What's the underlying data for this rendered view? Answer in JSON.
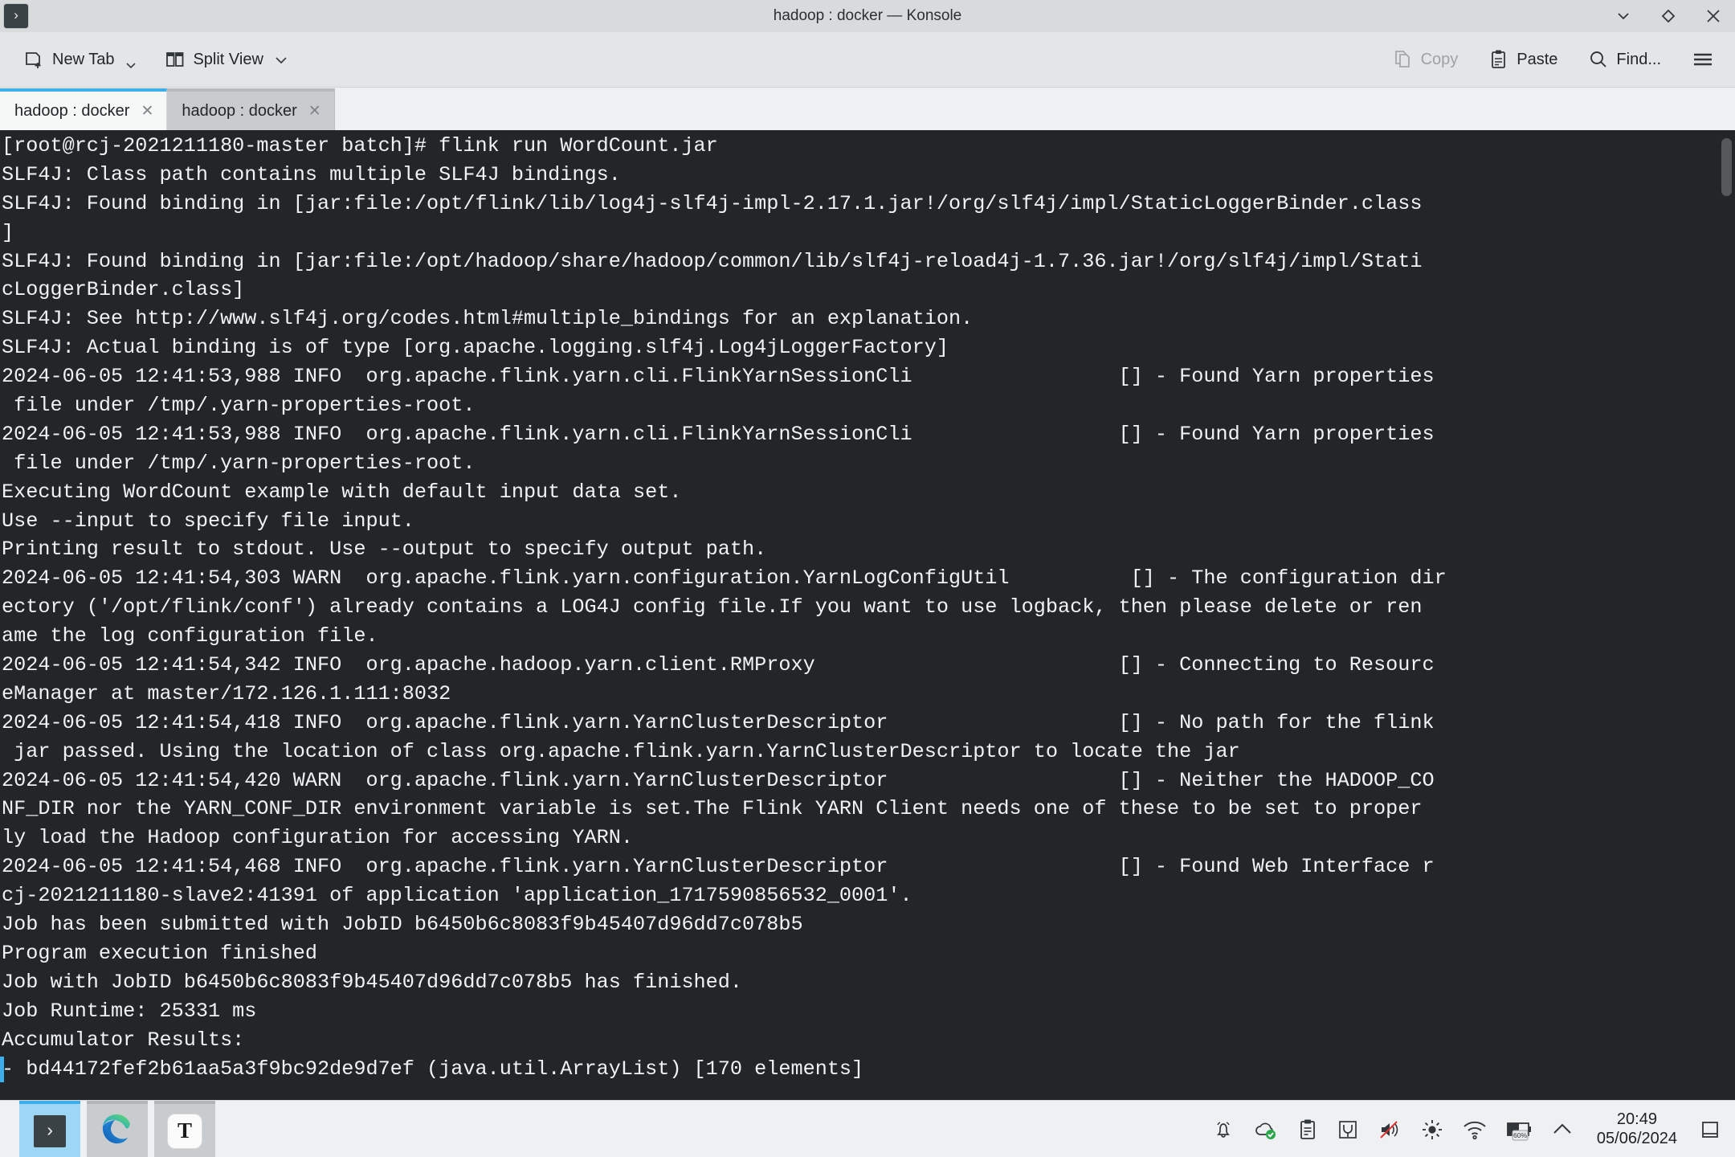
{
  "window": {
    "title": "hadoop : docker — Konsole",
    "app_icon": "konsole-prompt-icon",
    "controls": {
      "minimize": "⌄",
      "maximize": "◇",
      "close": "✕"
    }
  },
  "toolbar": {
    "new_tab_label": "New Tab",
    "split_view_label": "Split View",
    "copy_label": "Copy",
    "paste_label": "Paste",
    "find_label": "Find...",
    "menu_label": "hamburger-menu"
  },
  "tabs": [
    {
      "label": "hadoop : docker",
      "active": true,
      "close": "✕"
    },
    {
      "label": "hadoop : docker",
      "active": false,
      "close": "✕"
    }
  ],
  "terminal": {
    "background": "#232629",
    "foreground": "#f2f2f2",
    "cursor_color": "#3daee9",
    "prompt": "[root@rcj-2021211180-master batch]# ",
    "command": "flink run WordCount.jar",
    "lines": [
      "[root@rcj-2021211180-master batch]# flink run WordCount.jar",
      "SLF4J: Class path contains multiple SLF4J bindings.",
      "SLF4J: Found binding in [jar:file:/opt/flink/lib/log4j-slf4j-impl-2.17.1.jar!/org/slf4j/impl/StaticLoggerBinder.class",
      "]",
      "SLF4J: Found binding in [jar:file:/opt/hadoop/share/hadoop/common/lib/slf4j-reload4j-1.7.36.jar!/org/slf4j/impl/Stati",
      "cLoggerBinder.class]",
      "SLF4J: See http://www.slf4j.org/codes.html#multiple_bindings for an explanation.",
      "SLF4J: Actual binding is of type [org.apache.logging.slf4j.Log4jLoggerFactory]",
      "2024-06-05 12:41:53,988 INFO  org.apache.flink.yarn.cli.FlinkYarnSessionCli                 [] - Found Yarn properties",
      " file under /tmp/.yarn-properties-root.",
      "2024-06-05 12:41:53,988 INFO  org.apache.flink.yarn.cli.FlinkYarnSessionCli                 [] - Found Yarn properties",
      " file under /tmp/.yarn-properties-root.",
      "Executing WordCount example with default input data set.",
      "Use --input to specify file input.",
      "Printing result to stdout. Use --output to specify output path.",
      "2024-06-05 12:41:54,303 WARN  org.apache.flink.yarn.configuration.YarnLogConfigUtil          [] - The configuration dir",
      "ectory ('/opt/flink/conf') already contains a LOG4J config file.If you want to use logback, then please delete or ren",
      "ame the log configuration file.",
      "2024-06-05 12:41:54,342 INFO  org.apache.hadoop.yarn.client.RMProxy                         [] - Connecting to Resourc",
      "eManager at master/172.126.1.111:8032",
      "2024-06-05 12:41:54,418 INFO  org.apache.flink.yarn.YarnClusterDescriptor                   [] - No path for the flink",
      " jar passed. Using the location of class org.apache.flink.yarn.YarnClusterDescriptor to locate the jar",
      "2024-06-05 12:41:54,420 WARN  org.apache.flink.yarn.YarnClusterDescriptor                   [] - Neither the HADOOP_CO",
      "NF_DIR nor the YARN_CONF_DIR environment variable is set.The Flink YARN Client needs one of these to be set to proper",
      "ly load the Hadoop configuration for accessing YARN.",
      "2024-06-05 12:41:54,468 INFO  org.apache.flink.yarn.YarnClusterDescriptor                   [] - Found Web Interface r",
      "cj-2021211180-slave2:41391 of application 'application_1717590856532_0001'.",
      "Job has been submitted with JobID b6450b6c8083f9b45407d96dd7c078b5",
      "Program execution finished",
      "Job with JobID b6450b6c8083f9b45407d96dd7c078b5 has finished.",
      "Job Runtime: 25331 ms",
      "Accumulator Results:",
      "- bd44172fef2b61aa5a3f9bc92de9d7ef (java.util.ArrayList) [170 elements]"
    ],
    "cursor_line_index": 32
  },
  "taskbar": {
    "items": [
      {
        "name": "konsole",
        "glyph": "›",
        "active": true
      },
      {
        "name": "microsoft-edge",
        "glyph": "",
        "active": false
      },
      {
        "name": "text-editor",
        "glyph": "T",
        "active": false
      }
    ],
    "tray": [
      "notification-bell-icon",
      "cloud-sync-icon",
      "clipboard-icon",
      "usb-device-icon",
      "speaker-muted-icon",
      "brightness-icon",
      "wifi-icon",
      "battery-icon",
      "chevron-up-icon"
    ],
    "battery_level": "60%",
    "clock_time": "20:49",
    "clock_date": "05/06/2024",
    "show_desktop": "show-desktop-button"
  },
  "colors": {
    "accent": "#3daee9",
    "chrome": "#eff0f1",
    "terminal_bg": "#232629"
  }
}
